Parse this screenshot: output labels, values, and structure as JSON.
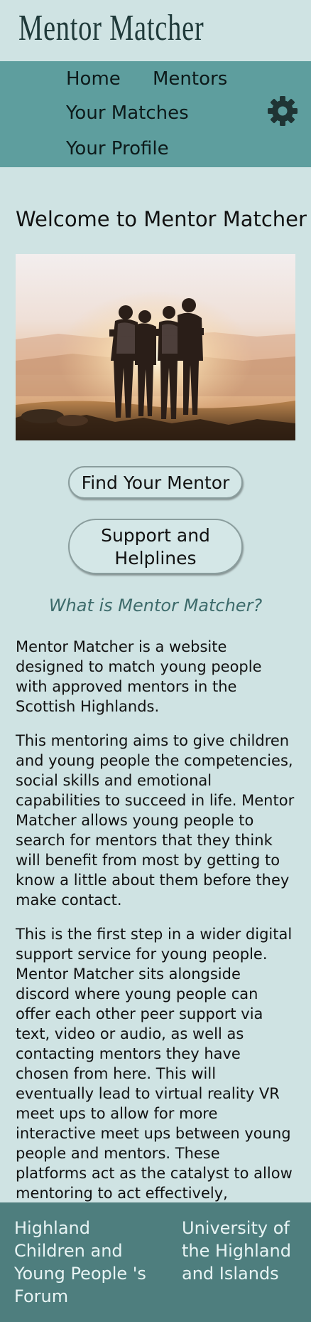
{
  "header": {
    "logo_text": "Mentor Matcher"
  },
  "nav": {
    "home": "Home",
    "mentors": "Mentors",
    "your_matches": "Your Matches",
    "your_profile": "Your Profile",
    "settings_icon": "gear-icon"
  },
  "main": {
    "title": "Welcome to Mentor Matcher",
    "hero_image": "photo of four young people with arms around each other facing a sunset",
    "find_mentor_button": "Find Your Mentor",
    "support_button": "Support and Helplines",
    "section_heading": "What is Mentor Matcher?",
    "paragraphs": [
      "Mentor Matcher is a website designed to match young people with approved mentors in the Scottish Highlands.",
      "This mentoring aims to give children and young people the competencies, social skills and emotional capabilities to succeed in life. Mentor Matcher allows young people to search for mentors that they think will benefit from most by getting to know a little about them before they make contact.",
      "This is the first step in a wider digital support service for young people. Mentor Matcher sits alongside discord where young people can offer each other peer support via text, video or audio, as well as contacting mentors they have chosen from here. This will eventually lead to virtual reality VR meet ups to allow for more interactive meet ups between young people and mentors. These platforms act as the catalyst to allow mentoring to act effectively, equipping young people with a voice, and offering them the advice and the capabilities to succeed."
    ]
  },
  "footer": {
    "left_link": "Highland Children and Young People 's Forum",
    "right_link": "University of the Highland and Islands"
  },
  "colors": {
    "page_background": "#cfe3e3",
    "nav_background": "#5e9e9e",
    "footer_background": "#4e7e7e",
    "heading_accent": "#3d6b6b"
  }
}
